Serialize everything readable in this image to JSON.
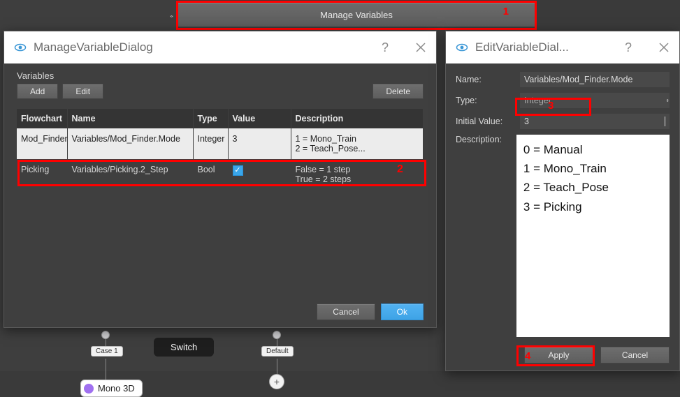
{
  "topbar": {
    "manage_label": "Manage Variables"
  },
  "annotations": {
    "a1": "1",
    "a2": "2",
    "a3": "3",
    "a4": "4"
  },
  "manageDialog": {
    "title": "ManageVariableDialog",
    "help": "?",
    "vars_label": "Variables",
    "add_label": "Add",
    "edit_label": "Edit",
    "delete_label": "Delete",
    "columns": {
      "flowchart": "Flowchart",
      "name": "Name",
      "type": "Type",
      "value": "Value",
      "description": "Description"
    },
    "rows": [
      {
        "flowchart": "Mod_Finder",
        "name": "Variables/Mod_Finder.Mode",
        "type": "Integer",
        "value": "3",
        "desc_l1": "1 = Mono_Train",
        "desc_l2": "2 = Teach_Pose..."
      },
      {
        "flowchart": "Picking",
        "name": "Variables/Picking.2_Step",
        "type": "Bool",
        "value_bool": true,
        "desc_l1": "False = 1 step",
        "desc_l2": "True = 2 steps"
      }
    ],
    "cancel_label": "Cancel",
    "ok_label": "Ok"
  },
  "editDialog": {
    "title": "EditVariableDial...",
    "help": "?",
    "name_label": "Name:",
    "name_value": "Variables/Mod_Finder.Mode",
    "type_label": "Type:",
    "type_value": "Integer",
    "initial_label": "Initial Value:",
    "initial_value": "3",
    "desc_label": "Description:",
    "desc_lines": {
      "l0": "0 = Manual",
      "l1": "1 = Mono_Train",
      "l2": "2 = Teach_Pose",
      "l3": "3 = Picking"
    },
    "apply_label": "Apply",
    "cancel_label": "Cancel"
  },
  "flowchart": {
    "switch_label": "Switch",
    "case1_label": "Case 1",
    "default_label": "Default",
    "mono_label": "Mono 3D"
  }
}
